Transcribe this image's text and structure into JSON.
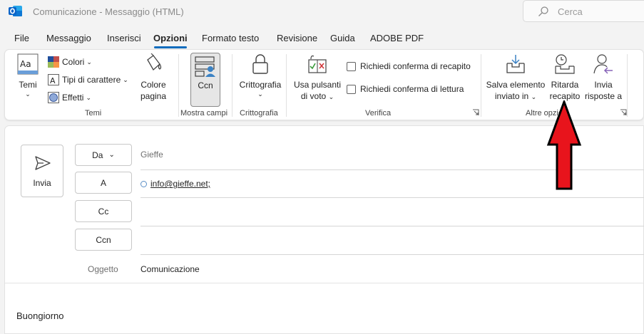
{
  "window": {
    "title": "Comunicazione - Messaggio (HTML)",
    "app_icon": "outlook-icon",
    "search_placeholder": "Cerca"
  },
  "menu": {
    "tabs": [
      "File",
      "Messaggio",
      "Inserisci",
      "Opzioni",
      "Formato testo",
      "Revisione",
      "Guida",
      "ADOBE PDF"
    ],
    "active": "Opzioni"
  },
  "ribbon": {
    "temi": {
      "themes_label": "Temi",
      "colors_label": "Colori",
      "fonts_label": "Tipi di carattere",
      "effects_label": "Effetti",
      "page_color_line1": "Colore",
      "page_color_line2": "pagina",
      "group_label": "Temi"
    },
    "mostra_campi": {
      "ccn_label": "Ccn",
      "group_label": "Mostra campi"
    },
    "crittografia": {
      "button_label": "Crittografia",
      "group_label": "Crittografia"
    },
    "verifica": {
      "voting_line1": "Usa pulsanti",
      "voting_line2": "di voto",
      "delivery_receipt": "Richiedi conferma di recapito",
      "read_receipt": "Richiedi conferma di lettura",
      "group_label": "Verifica"
    },
    "altre_opzioni": {
      "save_sent_line1": "Salva elemento",
      "save_sent_line2": "inviato in",
      "delay_line1": "Ritarda",
      "delay_line2": "recapito",
      "reply_line1": "Invia",
      "reply_line2": "risposte a",
      "group_label": "Altre opzioni"
    }
  },
  "compose": {
    "send_label": "Invia",
    "from_button": "Da",
    "from_value": "Gieffe",
    "to_button": "A",
    "to_value": "info@gieffe.net;",
    "cc_button": "Cc",
    "bcc_button": "Ccn",
    "subject_label": "Oggetto",
    "subject_value": "Comunicazione",
    "body_text": "Buongiorno"
  },
  "colors": {
    "accent": "#0f6cbd",
    "outlook_blue": "#0a64c8",
    "annotation_arrow": "#e8141c"
  }
}
